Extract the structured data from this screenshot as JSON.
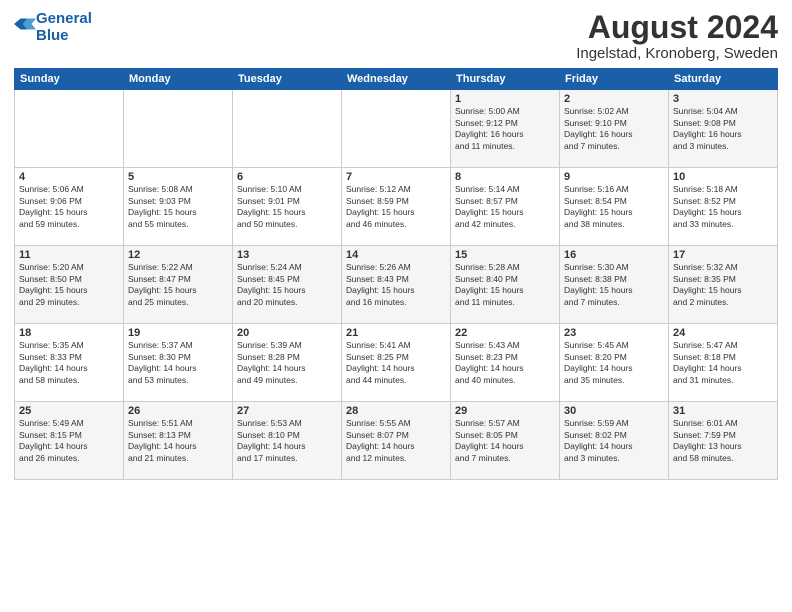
{
  "header": {
    "logo_line1": "General",
    "logo_line2": "Blue",
    "title": "August 2024",
    "subtitle": "Ingelstad, Kronoberg, Sweden"
  },
  "weekdays": [
    "Sunday",
    "Monday",
    "Tuesday",
    "Wednesday",
    "Thursday",
    "Friday",
    "Saturday"
  ],
  "weeks": [
    [
      {
        "day": "",
        "info": ""
      },
      {
        "day": "",
        "info": ""
      },
      {
        "day": "",
        "info": ""
      },
      {
        "day": "",
        "info": ""
      },
      {
        "day": "1",
        "info": "Sunrise: 5:00 AM\nSunset: 9:12 PM\nDaylight: 16 hours\nand 11 minutes."
      },
      {
        "day": "2",
        "info": "Sunrise: 5:02 AM\nSunset: 9:10 PM\nDaylight: 16 hours\nand 7 minutes."
      },
      {
        "day": "3",
        "info": "Sunrise: 5:04 AM\nSunset: 9:08 PM\nDaylight: 16 hours\nand 3 minutes."
      }
    ],
    [
      {
        "day": "4",
        "info": "Sunrise: 5:06 AM\nSunset: 9:06 PM\nDaylight: 15 hours\nand 59 minutes."
      },
      {
        "day": "5",
        "info": "Sunrise: 5:08 AM\nSunset: 9:03 PM\nDaylight: 15 hours\nand 55 minutes."
      },
      {
        "day": "6",
        "info": "Sunrise: 5:10 AM\nSunset: 9:01 PM\nDaylight: 15 hours\nand 50 minutes."
      },
      {
        "day": "7",
        "info": "Sunrise: 5:12 AM\nSunset: 8:59 PM\nDaylight: 15 hours\nand 46 minutes."
      },
      {
        "day": "8",
        "info": "Sunrise: 5:14 AM\nSunset: 8:57 PM\nDaylight: 15 hours\nand 42 minutes."
      },
      {
        "day": "9",
        "info": "Sunrise: 5:16 AM\nSunset: 8:54 PM\nDaylight: 15 hours\nand 38 minutes."
      },
      {
        "day": "10",
        "info": "Sunrise: 5:18 AM\nSunset: 8:52 PM\nDaylight: 15 hours\nand 33 minutes."
      }
    ],
    [
      {
        "day": "11",
        "info": "Sunrise: 5:20 AM\nSunset: 8:50 PM\nDaylight: 15 hours\nand 29 minutes."
      },
      {
        "day": "12",
        "info": "Sunrise: 5:22 AM\nSunset: 8:47 PM\nDaylight: 15 hours\nand 25 minutes."
      },
      {
        "day": "13",
        "info": "Sunrise: 5:24 AM\nSunset: 8:45 PM\nDaylight: 15 hours\nand 20 minutes."
      },
      {
        "day": "14",
        "info": "Sunrise: 5:26 AM\nSunset: 8:43 PM\nDaylight: 15 hours\nand 16 minutes."
      },
      {
        "day": "15",
        "info": "Sunrise: 5:28 AM\nSunset: 8:40 PM\nDaylight: 15 hours\nand 11 minutes."
      },
      {
        "day": "16",
        "info": "Sunrise: 5:30 AM\nSunset: 8:38 PM\nDaylight: 15 hours\nand 7 minutes."
      },
      {
        "day": "17",
        "info": "Sunrise: 5:32 AM\nSunset: 8:35 PM\nDaylight: 15 hours\nand 2 minutes."
      }
    ],
    [
      {
        "day": "18",
        "info": "Sunrise: 5:35 AM\nSunset: 8:33 PM\nDaylight: 14 hours\nand 58 minutes."
      },
      {
        "day": "19",
        "info": "Sunrise: 5:37 AM\nSunset: 8:30 PM\nDaylight: 14 hours\nand 53 minutes."
      },
      {
        "day": "20",
        "info": "Sunrise: 5:39 AM\nSunset: 8:28 PM\nDaylight: 14 hours\nand 49 minutes."
      },
      {
        "day": "21",
        "info": "Sunrise: 5:41 AM\nSunset: 8:25 PM\nDaylight: 14 hours\nand 44 minutes."
      },
      {
        "day": "22",
        "info": "Sunrise: 5:43 AM\nSunset: 8:23 PM\nDaylight: 14 hours\nand 40 minutes."
      },
      {
        "day": "23",
        "info": "Sunrise: 5:45 AM\nSunset: 8:20 PM\nDaylight: 14 hours\nand 35 minutes."
      },
      {
        "day": "24",
        "info": "Sunrise: 5:47 AM\nSunset: 8:18 PM\nDaylight: 14 hours\nand 31 minutes."
      }
    ],
    [
      {
        "day": "25",
        "info": "Sunrise: 5:49 AM\nSunset: 8:15 PM\nDaylight: 14 hours\nand 26 minutes."
      },
      {
        "day": "26",
        "info": "Sunrise: 5:51 AM\nSunset: 8:13 PM\nDaylight: 14 hours\nand 21 minutes."
      },
      {
        "day": "27",
        "info": "Sunrise: 5:53 AM\nSunset: 8:10 PM\nDaylight: 14 hours\nand 17 minutes."
      },
      {
        "day": "28",
        "info": "Sunrise: 5:55 AM\nSunset: 8:07 PM\nDaylight: 14 hours\nand 12 minutes."
      },
      {
        "day": "29",
        "info": "Sunrise: 5:57 AM\nSunset: 8:05 PM\nDaylight: 14 hours\nand 7 minutes."
      },
      {
        "day": "30",
        "info": "Sunrise: 5:59 AM\nSunset: 8:02 PM\nDaylight: 14 hours\nand 3 minutes."
      },
      {
        "day": "31",
        "info": "Sunrise: 6:01 AM\nSunset: 7:59 PM\nDaylight: 13 hours\nand 58 minutes."
      }
    ]
  ]
}
